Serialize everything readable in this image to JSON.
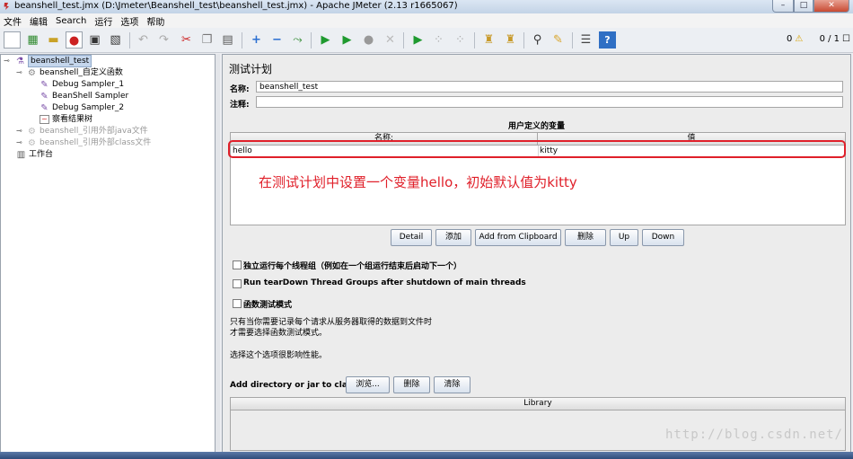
{
  "window": {
    "title": "beanshell_test.jmx (D:\\Jmeter\\Beanshell_test\\beanshell_test.jmx) - Apache JMeter (2.13 r1665067)",
    "min_label": "–",
    "max_label": "□",
    "close_label": "✕"
  },
  "menu": [
    "文件",
    "编辑",
    "Search",
    "运行",
    "选项",
    "帮助"
  ],
  "toolbar": {
    "icons": [
      "new-icon",
      "templates-icon",
      "open-icon",
      "close-file-icon",
      "save-icon",
      "save-as-icon",
      "undo-icon",
      "redo-icon",
      "cut-icon",
      "copy-icon",
      "paste-icon",
      "expand-icon",
      "collapse-icon",
      "toggle-icon",
      "start-icon",
      "start-no-pause-icon",
      "stop-icon",
      "shutdown-icon",
      "remote-start-icon",
      "remote-stop-icon",
      "remote-exit-icon",
      "clear-icon",
      "clear-all-icon",
      "search-icon",
      "reset-search-icon",
      "function-helper-icon",
      "help-icon"
    ],
    "warnings": "0",
    "threads": "0 / 1"
  },
  "tree": {
    "root": "beanshell_test",
    "items": [
      {
        "label": "beanshell_自定义函数",
        "icon": "thread-group-icon"
      },
      {
        "label": "Debug Sampler_1",
        "icon": "sampler-icon"
      },
      {
        "label": "BeanShell Sampler",
        "icon": "sampler-icon"
      },
      {
        "label": "Debug Sampler_2",
        "icon": "sampler-icon"
      },
      {
        "label": "察看结果树",
        "icon": "listener-icon"
      },
      {
        "label": "beanshell_引用外部java文件",
        "icon": "thread-group-icon"
      },
      {
        "label": "beanshell_引用外部class文件",
        "icon": "thread-group-icon"
      },
      {
        "label": "工作台",
        "icon": "workbench-icon"
      }
    ]
  },
  "panel": {
    "title": "测试计划",
    "name_label": "名称:",
    "name_value": "beanshell_test",
    "comments_label": "注释:",
    "comments_value": "",
    "vars_title": "用户定义的变量",
    "columns": [
      "名称:",
      "值"
    ],
    "rows": [
      [
        "hello",
        "kitty"
      ]
    ],
    "annotation": "在测试计划中设置一个变量hello，初始默认值为kitty",
    "buttons": [
      "Detail",
      "添加",
      "Add from Clipboard",
      "删除",
      "Up",
      "Down"
    ],
    "options": [
      {
        "label": "独立运行每个线程组（例如在一个组运行结束后启动下一个）",
        "checked": false
      },
      {
        "label": "Run tearDown Thread Groups after shutdown of main threads",
        "checked": false
      },
      {
        "label": "函数测试模式",
        "checked": false
      }
    ],
    "note_line1": "只有当你需要记录每个请求从服务器取得的数据到文件时",
    "note_line2": "才需要选择函数测试模式。",
    "note_line3": "选择这个选项很影响性能。",
    "classpath_label": "Add directory or jar to classpath",
    "classpath_buttons": [
      "浏览...",
      "删除",
      "清除"
    ],
    "library_header": "Library"
  },
  "watermark": "http://blog.csdn.net/",
  "colors": {
    "annotation": "#e0202a",
    "selection": "#c5d6ec"
  }
}
